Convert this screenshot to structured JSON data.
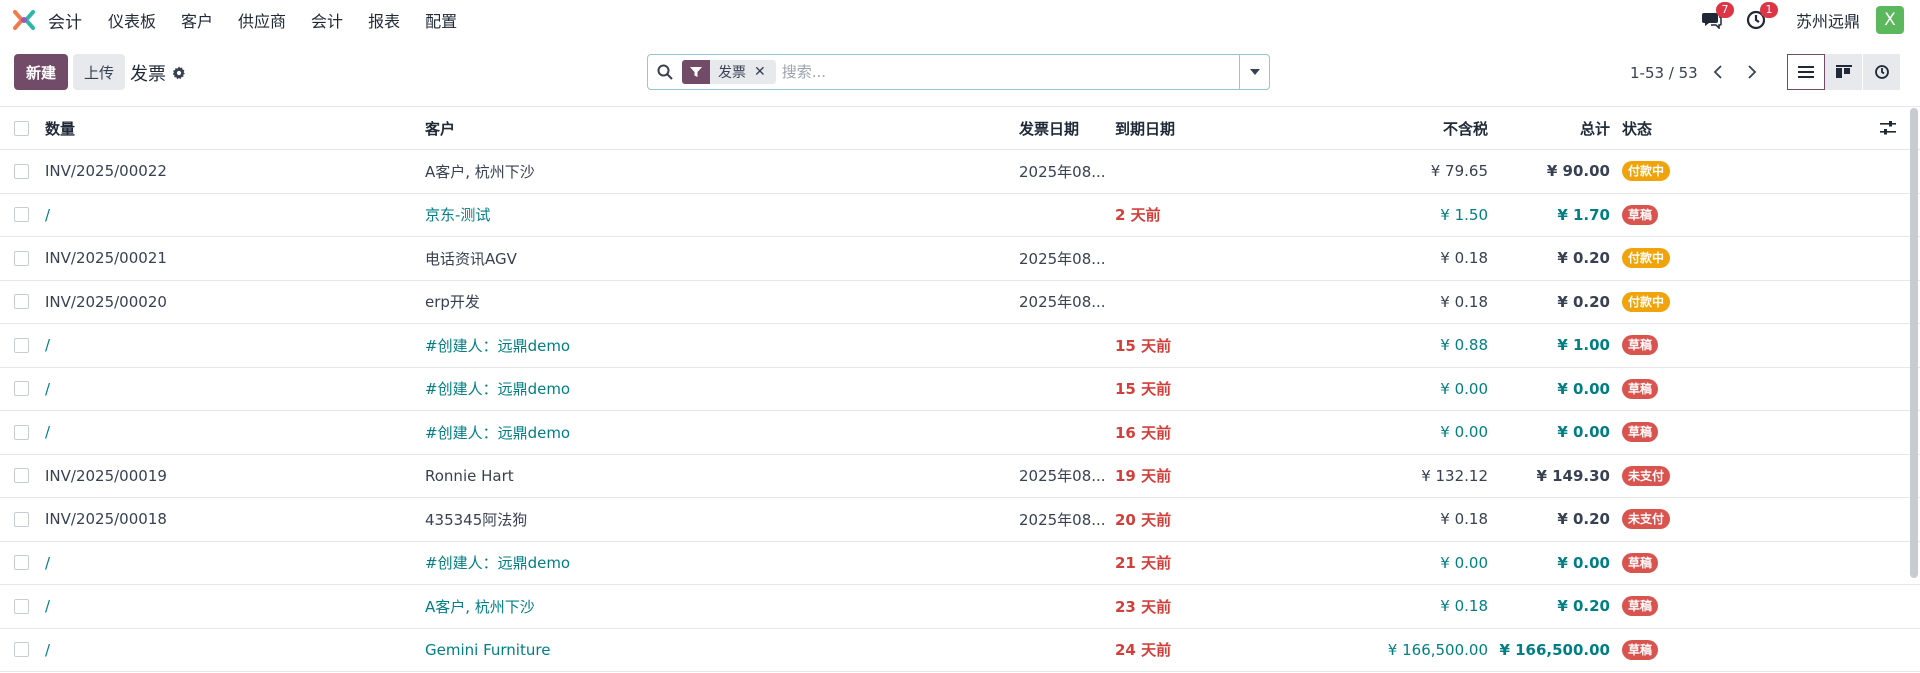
{
  "nav": {
    "app_name": "会计",
    "menu": [
      "仪表板",
      "客户",
      "供应商",
      "会计",
      "报表",
      "配置"
    ],
    "messages_count": "7",
    "activities_count": "1",
    "company": "苏州远鼎",
    "avatar_letter": "X"
  },
  "control": {
    "new_label": "新建",
    "upload_label": "上传",
    "breadcrumb": "发票",
    "facet_label": "发票",
    "search_placeholder": "搜索...",
    "pager": "1-53 / 53"
  },
  "table": {
    "headers": {
      "number": "数量",
      "customer": "客户",
      "invoice_date": "发票日期",
      "due_date": "到期日期",
      "untaxed": "不含税",
      "total": "总计",
      "status": "状态"
    },
    "rows": [
      {
        "number": "INV/2025/00022",
        "customer": "A客户, 杭州下沙",
        "invoice_date": "2025年08...",
        "due": "",
        "untaxed": "¥ 79.65",
        "total": "¥ 90.00",
        "status": "付款中",
        "kind": "posted"
      },
      {
        "number": "/",
        "customer": "京东-测试",
        "invoice_date": "",
        "due": "2 天前",
        "untaxed": "¥ 1.50",
        "total": "¥ 1.70",
        "status": "草稿",
        "kind": "draft"
      },
      {
        "number": "INV/2025/00021",
        "customer": "电话资讯AGV",
        "invoice_date": "2025年08...",
        "due": "",
        "untaxed": "¥ 0.18",
        "total": "¥ 0.20",
        "status": "付款中",
        "kind": "posted"
      },
      {
        "number": "INV/2025/00020",
        "customer": "erp开发",
        "invoice_date": "2025年08...",
        "due": "",
        "untaxed": "¥ 0.18",
        "total": "¥ 0.20",
        "status": "付款中",
        "kind": "posted"
      },
      {
        "number": "/",
        "customer": "#创建人：远鼎demo",
        "invoice_date": "",
        "due": "15 天前",
        "untaxed": "¥ 0.88",
        "total": "¥ 1.00",
        "status": "草稿",
        "kind": "draft"
      },
      {
        "number": "/",
        "customer": "#创建人：远鼎demo",
        "invoice_date": "",
        "due": "15 天前",
        "untaxed": "¥ 0.00",
        "total": "¥ 0.00",
        "status": "草稿",
        "kind": "draft"
      },
      {
        "number": "/",
        "customer": "#创建人：远鼎demo",
        "invoice_date": "",
        "due": "16 天前",
        "untaxed": "¥ 0.00",
        "total": "¥ 0.00",
        "status": "草稿",
        "kind": "draft"
      },
      {
        "number": "INV/2025/00019",
        "customer": "Ronnie Hart",
        "invoice_date": "2025年08...",
        "due": "19 天前",
        "untaxed": "¥ 132.12",
        "total": "¥ 149.30",
        "status": "未支付",
        "kind": "unpaid"
      },
      {
        "number": "INV/2025/00018",
        "customer": "435345阿法狗",
        "invoice_date": "2025年08...",
        "due": "20 天前",
        "untaxed": "¥ 0.18",
        "total": "¥ 0.20",
        "status": "未支付",
        "kind": "unpaid"
      },
      {
        "number": "/",
        "customer": "#创建人：远鼎demo",
        "invoice_date": "",
        "due": "21 天前",
        "untaxed": "¥ 0.00",
        "total": "¥ 0.00",
        "status": "草稿",
        "kind": "draft"
      },
      {
        "number": "/",
        "customer": "A客户, 杭州下沙",
        "invoice_date": "",
        "due": "23 天前",
        "untaxed": "¥ 0.18",
        "total": "¥ 0.20",
        "status": "草稿",
        "kind": "draft"
      },
      {
        "number": "/",
        "customer": "Gemini Furniture",
        "invoice_date": "",
        "due": "24 天前",
        "untaxed": "¥ 166,500.00",
        "total": "¥ 166,500.00",
        "status": "草稿",
        "kind": "draft"
      }
    ]
  },
  "colors": {
    "brand": "#714b67",
    "in_payment": "#f0a30a",
    "draft": "#d9534f",
    "unpaid": "#d9534f",
    "link": "#017e84",
    "overdue": "#d23f3a"
  }
}
